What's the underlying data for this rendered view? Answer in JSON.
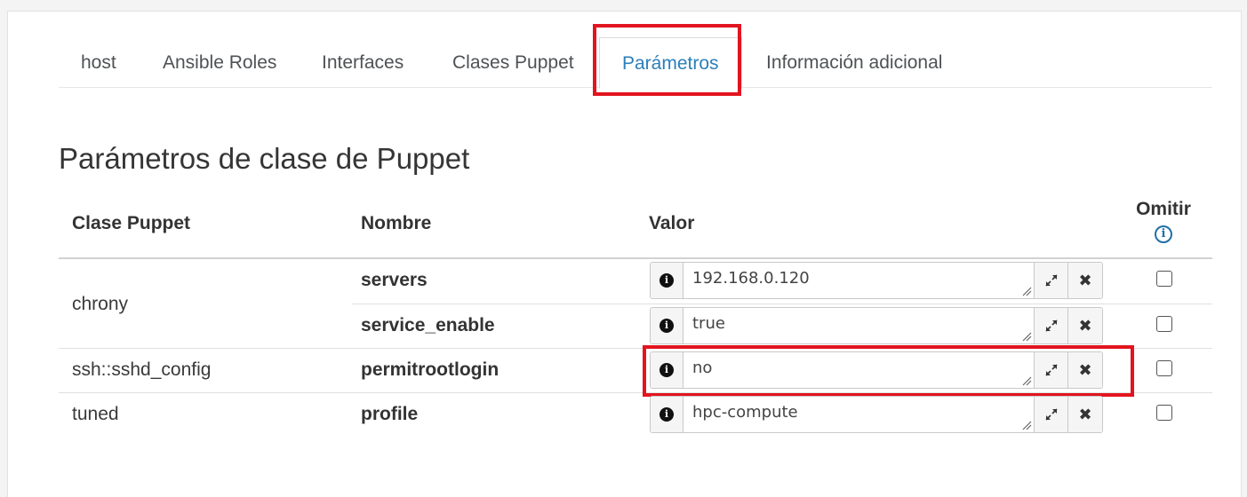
{
  "tabs": [
    {
      "label": "host"
    },
    {
      "label": "Ansible Roles"
    },
    {
      "label": "Interfaces"
    },
    {
      "label": "Clases Puppet"
    },
    {
      "label": "Parámetros"
    },
    {
      "label": "Información adicional"
    }
  ],
  "section_title": "Parámetros de clase de Puppet",
  "table": {
    "headers": {
      "clase": "Clase Puppet",
      "nombre": "Nombre",
      "valor": "Valor",
      "omitir": "Omitir"
    },
    "rows": [
      {
        "clase": "chrony",
        "nombre": "servers",
        "valor": "192.168.0.120",
        "omitir": false
      },
      {
        "clase": "",
        "nombre": "service_enable",
        "valor": "true",
        "omitir": false
      },
      {
        "clase": "ssh::sshd_config",
        "nombre": "permitrootlogin",
        "valor": "no",
        "omitir": false
      },
      {
        "clase": "tuned",
        "nombre": "profile",
        "valor": "hpc-compute",
        "omitir": false
      }
    ]
  },
  "icons": {
    "info_addon": "info-icon",
    "expand": "expand-icon",
    "remove": "remove-icon",
    "omit_help": "info-circle-icon"
  },
  "colors": {
    "active_tab": "#2b7fb8",
    "highlight": "#e2141f"
  }
}
